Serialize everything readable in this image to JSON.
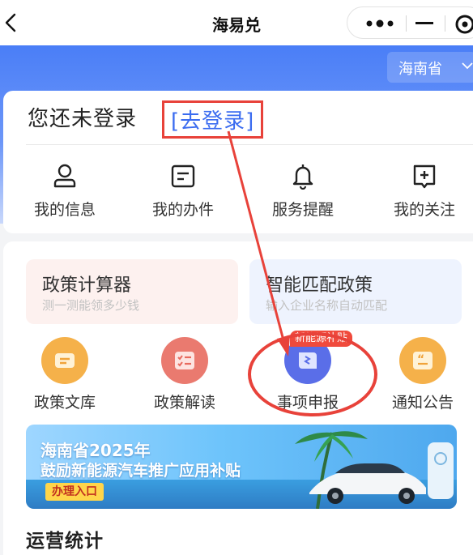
{
  "nav": {
    "title": "海易兑"
  },
  "header": {
    "region": "海南省"
  },
  "login": {
    "prompt": "您还未登录",
    "link": "[去登录]"
  },
  "quick_links": [
    {
      "label": "我的信息",
      "icon": "user-icon"
    },
    {
      "label": "我的办件",
      "icon": "document-icon"
    },
    {
      "label": "服务提醒",
      "icon": "bell-icon"
    },
    {
      "label": "我的关注",
      "icon": "bookmark-plus-icon"
    }
  ],
  "tools": [
    {
      "title": "政策计算器",
      "subtitle": "测一测能领多少钱"
    },
    {
      "title": "智能匹配政策",
      "subtitle": "输入企业名称自动匹配"
    }
  ],
  "services": [
    {
      "label": "政策文库",
      "icon": "library-icon",
      "color": "#f0a33a"
    },
    {
      "label": "政策解读",
      "icon": "checklist-icon",
      "color": "#e86a5e"
    },
    {
      "label": "事项申报",
      "icon": "application-icon",
      "color": "#5a6ee8"
    },
    {
      "label": "通知公告",
      "icon": "quote-icon",
      "color": "#f0a33a"
    }
  ],
  "badge": "新能源补贴",
  "banner": {
    "line1": "海南省2025年",
    "line2": "鼓励新能源汽车推广应用补贴",
    "button": "办理入口"
  },
  "section": {
    "title": "运营统计"
  },
  "colors": {
    "accent": "#3b6cf0",
    "annotation": "#e8423a"
  }
}
